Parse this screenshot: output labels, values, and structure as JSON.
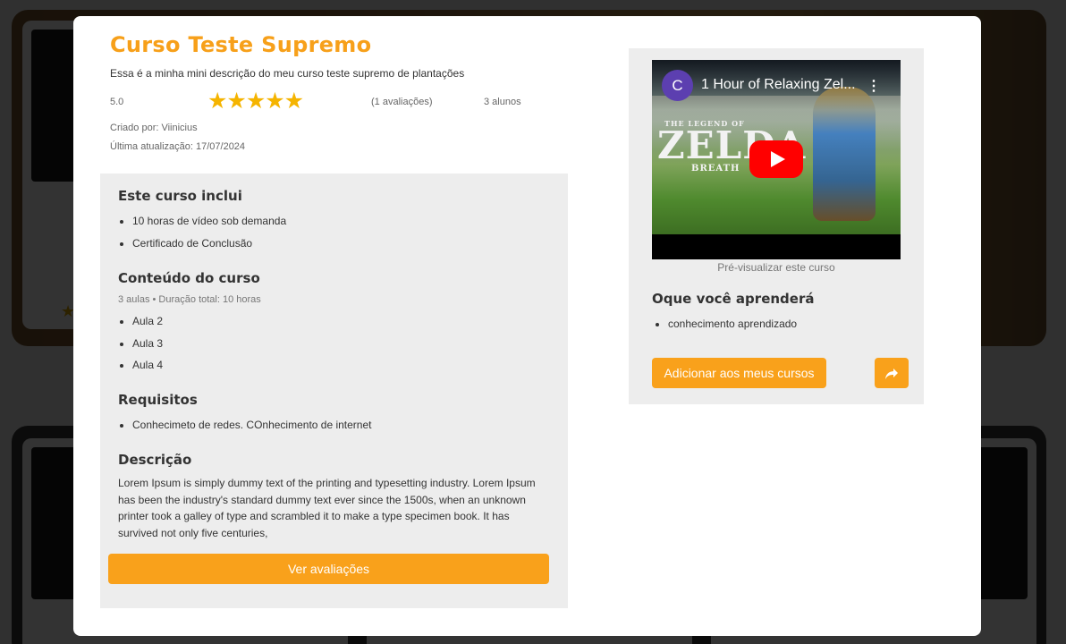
{
  "course": {
    "title": "Curso Teste Supremo",
    "short_description": "Essa é a minha mini descrição do meu curso teste supremo de plantações",
    "rating_value": "5.0",
    "rating_stars": 5,
    "stars_text": "★★★★★",
    "reviews_count": "(1 avaliações)",
    "students": "3 alunos",
    "created_by": "Criado por: Viinicius",
    "last_update": "Última atualização: 17/07/2024"
  },
  "includes": {
    "title": "Este curso inclui",
    "items": [
      "10 horas de vídeo sob demanda",
      "Certificado de Conclusão"
    ]
  },
  "content": {
    "title": "Conteúdo do curso",
    "summary": "3 aulas • Duração total: 10 horas",
    "lessons": [
      "Aula 2",
      "Aula 3",
      "Aula 4"
    ]
  },
  "requirements": {
    "title": "Requisitos",
    "items": [
      "Conhecimeto de redes. COnhecimento de internet"
    ]
  },
  "description": {
    "title": "Descrição",
    "text": "Lorem Ipsum is simply dummy text of the printing and typesetting industry. Lorem Ipsum has been the industry's standard dummy text ever since the 1500s, when an unknown printer took a galley of type and scrambled it to make a type specimen book. It has survived not only five centuries,"
  },
  "buttons": {
    "reviews": "Ver avaliações",
    "add_to_courses": "Adicionar aos meus cursos",
    "share_icon": "share-icon"
  },
  "video": {
    "channel_initial": "C",
    "title": "1 Hour of Relaxing Zel...",
    "menu_icon": "⋮",
    "game_logo_small": "THE LEGEND OF",
    "game_logo_big": "ZELDA",
    "game_logo_sub": "BREATH",
    "preview_label": "Pré-visualizar este curso"
  },
  "learn": {
    "title": "Oque você aprenderá",
    "items": [
      "conhecimento aprendizado"
    ]
  },
  "colors": {
    "accent": "#f9a11b",
    "title": "#f7a01a",
    "star": "#f5b400",
    "panel": "#ededed"
  }
}
